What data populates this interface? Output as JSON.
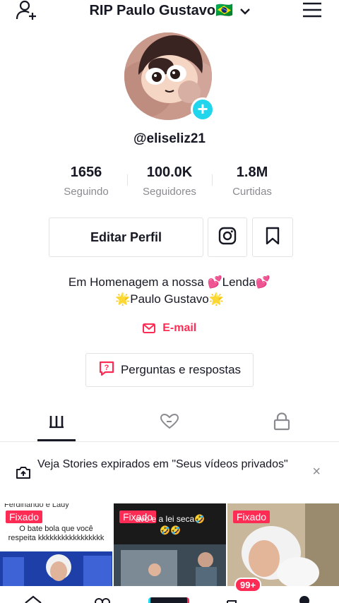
{
  "header": {
    "title": "RIP Paulo Gustavo🇧🇷",
    "add_user_icon": "add-user-icon",
    "menu_icon": "hamburger-menu-icon"
  },
  "profile": {
    "username": "@eliseliz21",
    "add_button": "+"
  },
  "stats": [
    {
      "value": "1656",
      "label": "Seguindo"
    },
    {
      "value": "100.0K",
      "label": "Seguidores"
    },
    {
      "value": "1.8M",
      "label": "Curtidas"
    }
  ],
  "actions": {
    "edit_profile": "Editar Perfil",
    "instagram_icon": "instagram-icon",
    "bookmark_icon": "bookmark-icon"
  },
  "bio": {
    "line1": "Em Homenagem a nossa 💕Lenda💕",
    "line2": "🌟Paulo Gustavo🌟"
  },
  "email": {
    "label": "E-mail"
  },
  "qa": {
    "label": "Perguntas e respostas"
  },
  "tabs": [
    {
      "name": "videos",
      "icon": "grid-icon",
      "active": true
    },
    {
      "name": "liked",
      "icon": "liked-heart-icon",
      "active": false
    },
    {
      "name": "private",
      "icon": "lock-icon",
      "active": false
    }
  ],
  "banner": {
    "text": "Veja Stories expirados em \"Seus vídeos privados\"",
    "close": "×"
  },
  "videos": [
    {
      "pinned": "Fixado",
      "caption_top": "Ferdinando e Lady",
      "caption": "O bate bola que você respeita kkkkkkkkkkkkkkkkk"
    },
    {
      "pinned": "Fixado",
      "caption": "avo e a lei seca🤣🤣🤣"
    },
    {
      "pinned": "Fixado",
      "caption": ""
    }
  ],
  "bottom_nav": {
    "inbox_badge": "99+"
  },
  "colors": {
    "accent": "#fe2c55",
    "cyan": "#20d5ec",
    "text": "#161823",
    "muted": "#8a8b91"
  }
}
